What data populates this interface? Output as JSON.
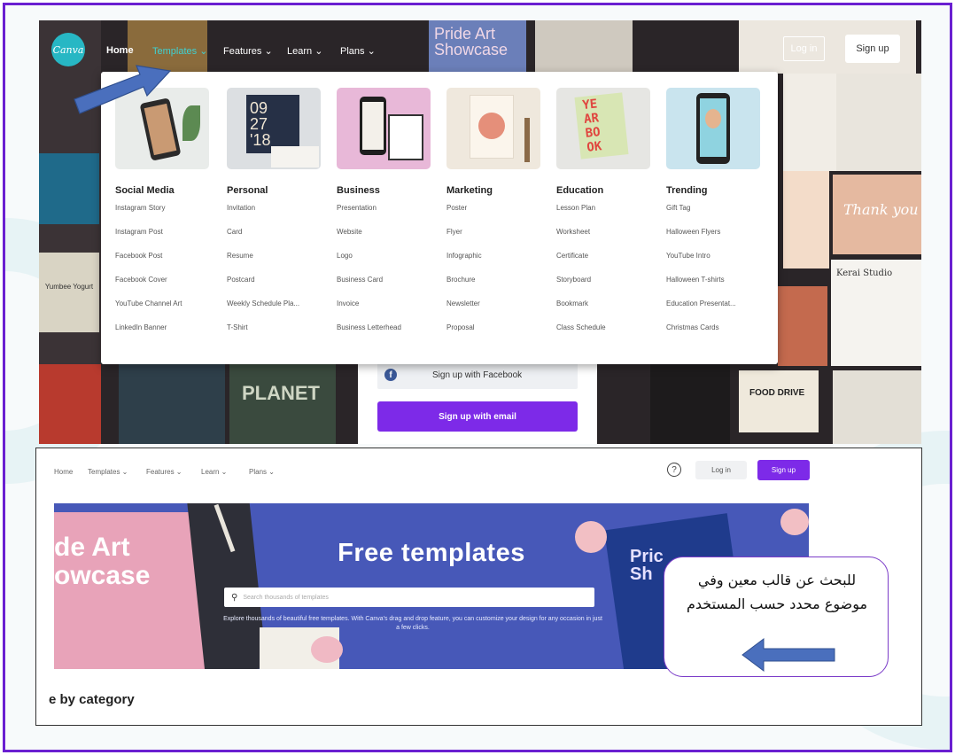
{
  "top_screenshot": {
    "nav": {
      "logo": "Canva",
      "home": "Home",
      "templates": "Templates ⌄",
      "features": "Features ⌄",
      "learn": "Learn ⌄",
      "plans": "Plans ⌄",
      "login": "Log in",
      "signup": "Sign up"
    },
    "background_texts": {
      "pride": "Pride Art Showcase",
      "planet": "PLANET",
      "thank_you": "Thank you",
      "kerai": "Kerai Studio",
      "food_drive": "FOOD DRIVE",
      "yumbee": "Yumbee Yogurt"
    },
    "dropdown": {
      "columns": [
        {
          "title": "Social Media",
          "thumb_text": "",
          "items": [
            "Instagram Story",
            "Instagram Post",
            "Facebook Post",
            "Facebook Cover",
            "YouTube Channel Art",
            "LinkedIn Banner"
          ]
        },
        {
          "title": "Personal",
          "thumb_text": "09 27 '18",
          "items": [
            "Invitation",
            "Card",
            "Resume",
            "Postcard",
            "Weekly Schedule Pla...",
            "T-Shirt"
          ]
        },
        {
          "title": "Business",
          "thumb_text": "",
          "items": [
            "Presentation",
            "Website",
            "Logo",
            "Business Card",
            "Invoice",
            "Business Letterhead"
          ]
        },
        {
          "title": "Marketing",
          "thumb_text": "",
          "items": [
            "Poster",
            "Flyer",
            "Infographic",
            "Brochure",
            "Newsletter",
            "Proposal"
          ]
        },
        {
          "title": "Education",
          "thumb_text": "YE AR BO OK",
          "items": [
            "Lesson Plan",
            "Worksheet",
            "Certificate",
            "Storyboard",
            "Bookmark",
            "Class Schedule"
          ]
        },
        {
          "title": "Trending",
          "thumb_text": "",
          "items": [
            "Gift Tag",
            "Halloween Flyers",
            "YouTube Intro",
            "Halloween T-shirts",
            "Education Presentat...",
            "Christmas Cards"
          ]
        }
      ]
    },
    "signup_facebook": "Sign up with Facebook",
    "signup_email": "Sign up with email"
  },
  "bottom_screenshot": {
    "nav": {
      "home": "Home",
      "templates": "Templates ⌄",
      "features": "Features ⌄",
      "learn": "Learn ⌄",
      "plans": "Plans ⌄",
      "help": "?",
      "login": "Log in",
      "signup": "Sign up"
    },
    "hero": {
      "title": "Free templates",
      "search_placeholder": "Search thousands of templates",
      "description": "Explore thousands of beautiful free templates. With Canva's drag and drop feature, you can customize your design for any occasion in just a few clicks.",
      "left_poster_text": "de Art owcase",
      "right_poster_text": "Pric Sh"
    },
    "category_heading": "e by category"
  },
  "annotation": {
    "callout_text": "للبحث عن قالب معين وفي موضوع محدد حسب المستخدم"
  },
  "colors": {
    "frame_border": "#6a1fd1",
    "canva_purple": "#7d2ae8",
    "arrow_blue": "#4a6fbd",
    "hero_blue": "#4758b8"
  }
}
